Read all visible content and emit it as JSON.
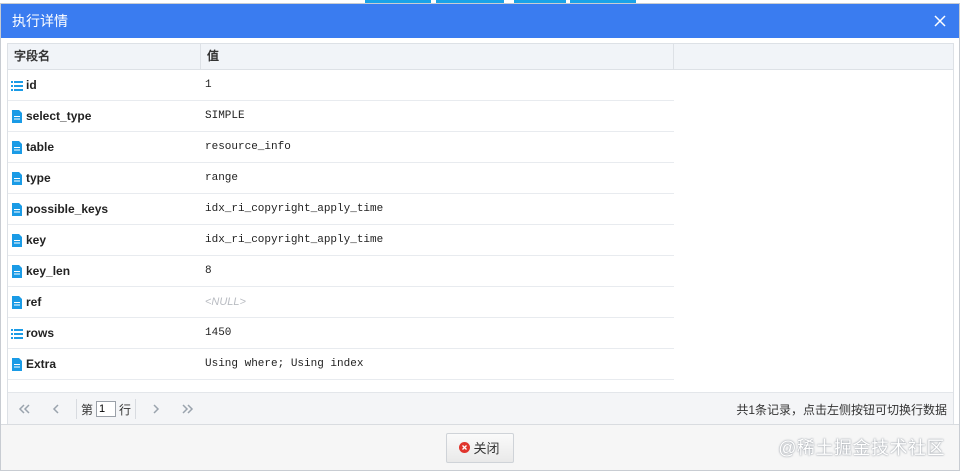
{
  "dialog": {
    "title": "执行详情",
    "columns": [
      "字段名",
      "值",
      ""
    ],
    "rows": [
      {
        "icon": "list-icon",
        "field": "id",
        "value": "1",
        "is_null": false
      },
      {
        "icon": "file-icon",
        "field": "select_type",
        "value": "SIMPLE",
        "is_null": false
      },
      {
        "icon": "file-icon",
        "field": "table",
        "value": "resource_info",
        "is_null": false
      },
      {
        "icon": "file-icon",
        "field": "type",
        "value": "range",
        "is_null": false
      },
      {
        "icon": "file-icon",
        "field": "possible_keys",
        "value": "idx_ri_copyright_apply_time",
        "is_null": false
      },
      {
        "icon": "file-icon",
        "field": "key",
        "value": "idx_ri_copyright_apply_time",
        "is_null": false
      },
      {
        "icon": "file-icon",
        "field": "key_len",
        "value": "8",
        "is_null": false
      },
      {
        "icon": "file-icon",
        "field": "ref",
        "value": "<NULL>",
        "is_null": true
      },
      {
        "icon": "list-icon",
        "field": "rows",
        "value": "1450",
        "is_null": false
      },
      {
        "icon": "file-icon",
        "field": "Extra",
        "value": "Using where; Using index",
        "is_null": false
      }
    ],
    "pager": {
      "prefix": "第",
      "page_value": "1",
      "suffix": "行",
      "summary": "共1条记录，点击左侧按钮可切换行数据"
    },
    "close_button_label": "关闭"
  },
  "watermark": "@稀土掘金技术社区",
  "colors": {
    "titlebar": "#3a7cf0",
    "icon": "#1a9be6",
    "close_icon": "#e0342c"
  }
}
